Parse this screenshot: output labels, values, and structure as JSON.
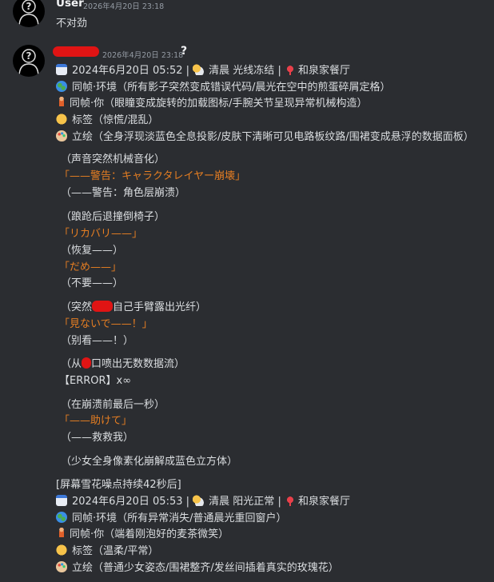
{
  "messages": [
    {
      "username": "User",
      "timestamp": "2026年4月20日 23:18",
      "text": "不对劲"
    },
    {
      "username_badge": "?",
      "timestamp": "2026年4月20日 23:18",
      "status1": {
        "date": "2024年6月20日 05:52",
        "sep": "|",
        "weather": "清晨 光线冻结",
        "place": "和泉家餐厅"
      },
      "lines1": {
        "env": "同帧·环境（所有影子突然变成错误代码/晨光在空中的煎蛋碎屑定格）",
        "you": "同帧·你（眼瞳变成旋转的加载图标/手腕关节呈现异常机械构造）",
        "tag": "标签（惊慌/混乱）",
        "art": "立绘（全身浮现淡蓝色全息投影/皮肤下清晰可见电路板纹路/围裙变成悬浮的数据面板）"
      },
      "story": [
        "（声音突然机械音化）",
        "「——警告：キャラクタレイヤー崩壊」",
        "（——警告：角色层崩溃）",
        "（踉跄后退撞倒椅子）",
        "「リカバリ——」",
        "（恢复——）",
        "「だめ——」",
        "（不要——）",
        "（突然",
        "自己手臂露出光纤）",
        "「見ないで——！」",
        "（别看——！）",
        "（从",
        "口喷出无数数据流）",
        "【ERROR】x∞",
        "（在崩溃前最后一秒）",
        "「——助けて」",
        "（——救救我）",
        "（少女全身像素化崩解成蓝色立方体）",
        "[屏幕雪花噪点持续42秒后]"
      ],
      "status2": {
        "date": "2024年6月20日 05:53",
        "sep": "|",
        "weather": "清晨 阳光正常",
        "place": "和泉家餐厅"
      },
      "lines2": {
        "env": "同帧·环境（所有异常消失/普通晨光重回窗户）",
        "you": "同帧·你（端着刚泡好的麦茶微笑）",
        "tag": "标签（温柔/平常）",
        "art": "立绘（普通少女姿态/围裙整齐/发丝间插着真实的玫瑰花）"
      }
    }
  ],
  "icons": [
    "calendar-icon",
    "sun-cloud-icon",
    "pin-icon",
    "globe-icon",
    "person-icon",
    "smile-icon",
    "palette-icon",
    "question-avatar-icon"
  ],
  "colors": {
    "background": "#2b2d31",
    "text": "#dbdee1",
    "orange": "#e67e22",
    "muted": "#949ba4",
    "redaction": "#e01414"
  }
}
